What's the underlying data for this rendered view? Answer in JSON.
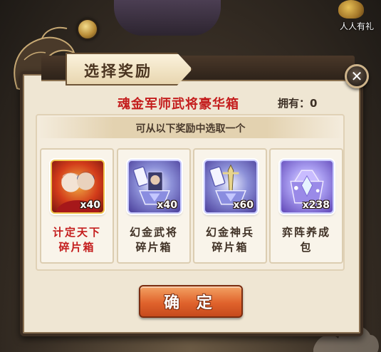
{
  "dialog": {
    "title": "选择奖励",
    "chest_name": "魂金军师武将豪华箱",
    "own_label": "拥有：0",
    "instruction": "可从以下奖励中选取一个",
    "confirm_label": "确 定"
  },
  "corner_widget": {
    "label": "人人有礼"
  },
  "rewards": [
    {
      "name_line1": "计定天下",
      "name_line2": "碎片箱",
      "qty": "x40",
      "icon": "red-hero-fragment-chest-icon"
    },
    {
      "name_line1": "幻金武将",
      "name_line2": "碎片箱",
      "qty": "x40",
      "icon": "gold-general-fragment-chest-icon"
    },
    {
      "name_line1": "幻金神兵",
      "name_line2": "碎片箱",
      "qty": "x60",
      "icon": "gold-weapon-fragment-chest-icon"
    },
    {
      "name_line1": "弈阵养成",
      "name_line2": "包",
      "qty": "x238",
      "icon": "crystal-gift-pack-icon"
    }
  ],
  "colors": {
    "title_red": "#c41d1d",
    "button_orange": "#e0632c",
    "panel_cream": "#efe6d3",
    "frame_brown": "#3d2e22"
  }
}
